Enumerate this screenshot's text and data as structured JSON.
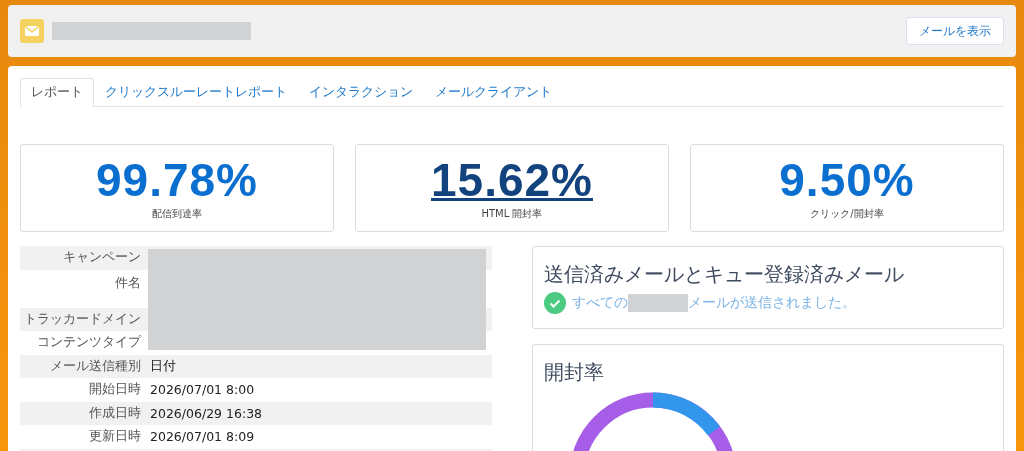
{
  "header": {
    "button": "メールを表示"
  },
  "tabs": [
    {
      "label": "レポート",
      "selected": true
    },
    {
      "label": "クリックスルーレートレポート",
      "selected": false
    },
    {
      "label": "インタラクション",
      "selected": false
    },
    {
      "label": "メールクライアント",
      "selected": false
    }
  ],
  "metrics": [
    {
      "value": "99.78%",
      "label": "配信到達率",
      "link": false
    },
    {
      "value": "15.62%",
      "label": "HTML 開封率",
      "link": true
    },
    {
      "value": "9.50%",
      "label": "クリック/開封率",
      "link": false
    }
  ],
  "details": [
    {
      "label": "キャンペーン",
      "tall": false
    },
    {
      "label": "件名",
      "tall": true
    },
    {
      "label": "トラッカードメイン",
      "tall": false
    },
    {
      "label": "コンテンツタイプ",
      "tall": false
    },
    {
      "label": "メール送信種別",
      "value": "日付",
      "tall": false
    },
    {
      "label": "開始日時",
      "value": "2026/07/01 8:00",
      "tall": false
    },
    {
      "label": "作成日時",
      "value": "2026/06/29 16:38",
      "tall": false
    },
    {
      "label": "更新日時",
      "value": "2026/07/01 8:09",
      "tall": false
    }
  ],
  "send_status": {
    "title": "送信済みメールとキュー登録済みメール",
    "text_before": "すべての",
    "text_after": "メールが送信されました。"
  },
  "open_rate": {
    "title": "開封率"
  }
}
